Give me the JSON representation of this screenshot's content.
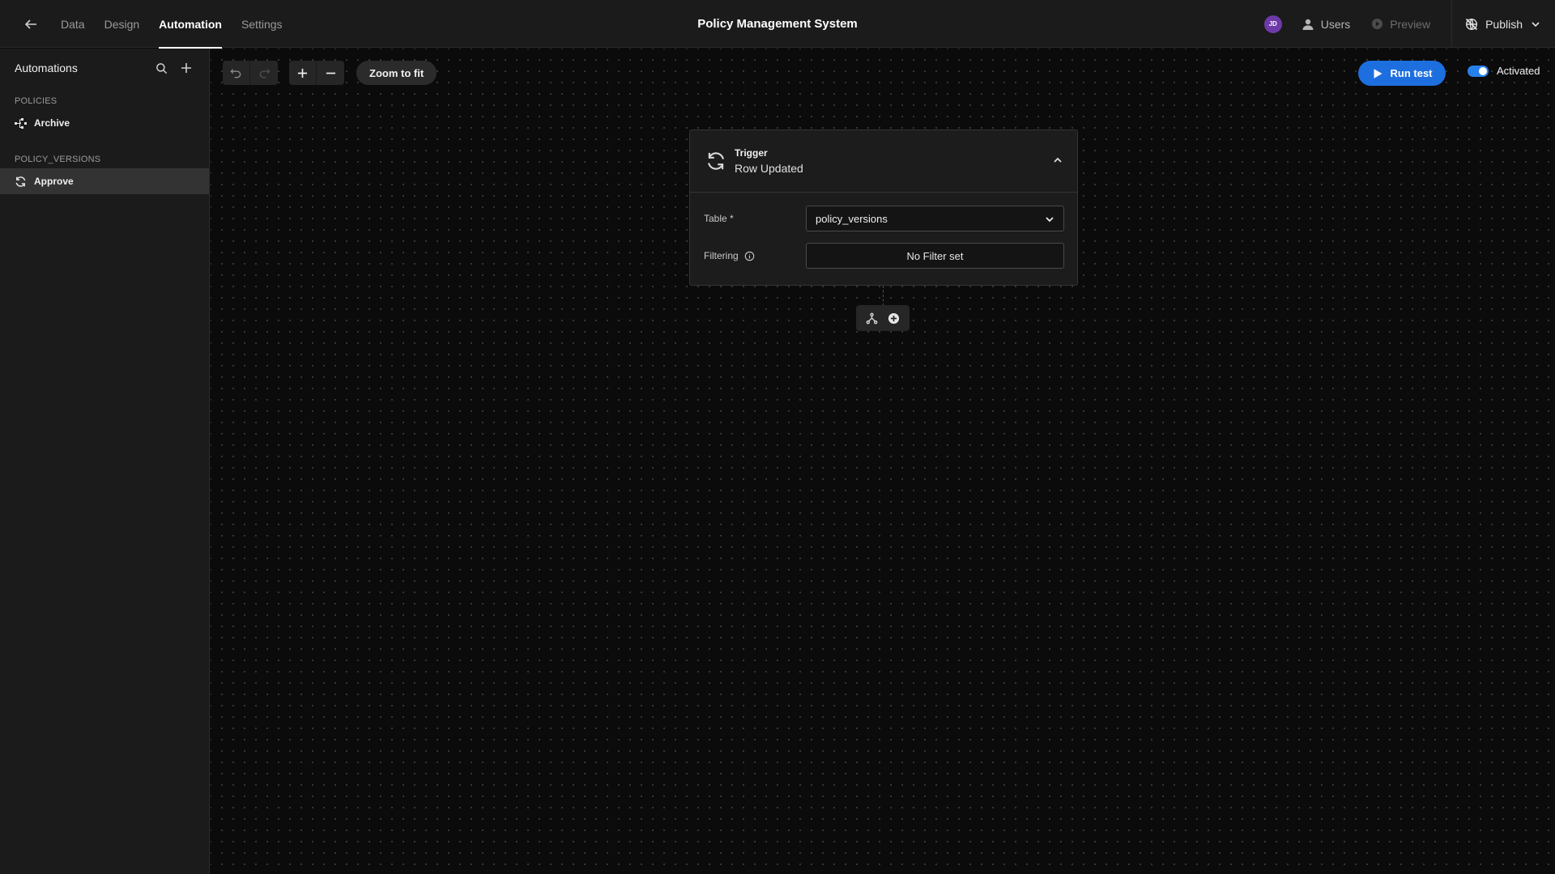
{
  "header": {
    "tabs": [
      {
        "label": "Data",
        "active": false
      },
      {
        "label": "Design",
        "active": false
      },
      {
        "label": "Automation",
        "active": true
      },
      {
        "label": "Settings",
        "active": false
      }
    ],
    "app_title": "Policy Management System",
    "avatar_initials": "JD",
    "users_label": "Users",
    "preview_label": "Preview",
    "publish_label": "Publish"
  },
  "sidebar": {
    "title": "Automations",
    "sections": [
      {
        "name": "POLICIES",
        "items": [
          {
            "label": "Archive",
            "icon": "flow-icon",
            "selected": false
          }
        ]
      },
      {
        "name": "POLICY_VERSIONS",
        "items": [
          {
            "label": "Approve",
            "icon": "refresh-icon",
            "selected": true
          }
        ]
      }
    ]
  },
  "canvas": {
    "toolbar": {
      "zoom_to_fit_label": "Zoom to fit",
      "run_test_label": "Run test",
      "activated_label": "Activated",
      "activated": true
    },
    "trigger": {
      "kind_label": "Trigger",
      "event_label": "Row Updated",
      "table_label": "Table *",
      "table_value": "policy_versions",
      "filtering_label": "Filtering",
      "filter_value": "No Filter set"
    }
  },
  "colors": {
    "accent": "#1d6fe0",
    "toggle": "#2680eb",
    "avatar": "#6e3aa8",
    "background": "#0b0b0b",
    "panel": "#1b1b1b"
  }
}
